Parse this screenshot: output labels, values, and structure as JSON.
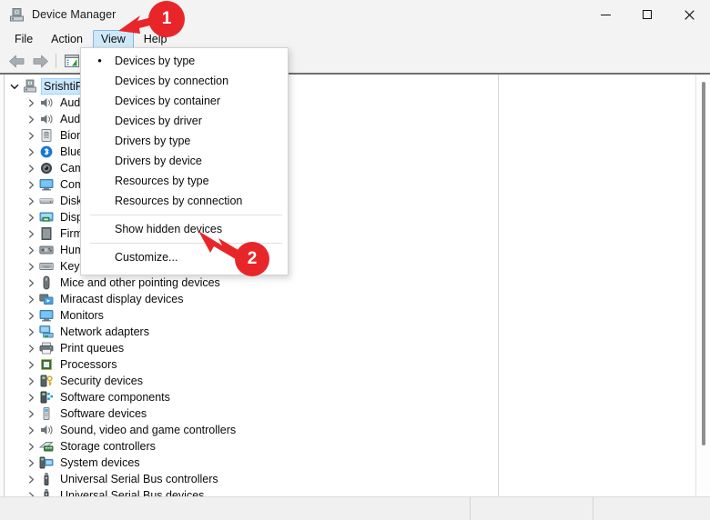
{
  "window": {
    "title": "Device Manager",
    "icon": "device-manager-icon",
    "controls": {
      "minimize": "—",
      "maximize": "□",
      "close": "✕"
    }
  },
  "menubar": {
    "items": [
      {
        "label": "File",
        "active": false
      },
      {
        "label": "Action",
        "active": false
      },
      {
        "label": "View",
        "active": true
      },
      {
        "label": "Help",
        "active": false
      }
    ]
  },
  "toolbar": {
    "buttons": [
      {
        "name": "back-button",
        "icon": "back-arrow-icon"
      },
      {
        "name": "forward-button",
        "icon": "forward-arrow-icon"
      },
      {
        "name": "properties-button",
        "icon": "properties-icon"
      }
    ]
  },
  "view_menu": {
    "items": [
      {
        "label": "Devices by type",
        "checked": true
      },
      {
        "label": "Devices by connection",
        "checked": false
      },
      {
        "label": "Devices by container",
        "checked": false
      },
      {
        "label": "Devices by driver",
        "checked": false
      },
      {
        "label": "Drivers by type",
        "checked": false
      },
      {
        "label": "Drivers by device",
        "checked": false
      },
      {
        "label": "Resources by type",
        "checked": false
      },
      {
        "label": "Resources by connection",
        "checked": false
      },
      {
        "separator": true
      },
      {
        "label": "Show hidden devices",
        "checked": false
      },
      {
        "separator": true
      },
      {
        "label": "Customize...",
        "checked": false
      }
    ]
  },
  "tree": {
    "root": {
      "label": "SrishtiPC",
      "icon": "computer-icon",
      "expanded": true,
      "selected": true
    },
    "items": [
      {
        "label": "Audio inputs and outputs",
        "icon": "speaker-icon"
      },
      {
        "label": "Audio inputs and outputs",
        "icon": "speaker-icon"
      },
      {
        "label": "Biometric devices",
        "icon": "fingerprint-icon"
      },
      {
        "label": "Bluetooth",
        "icon": "bluetooth-icon"
      },
      {
        "label": "Cameras",
        "icon": "camera-icon"
      },
      {
        "label": "Computer",
        "icon": "monitor-icon"
      },
      {
        "label": "Disk drives",
        "icon": "disk-icon"
      },
      {
        "label": "Display adapters",
        "icon": "display-adapter-icon"
      },
      {
        "label": "Firmware",
        "icon": "firmware-icon"
      },
      {
        "label": "Human Interface Devices",
        "icon": "hid-icon"
      },
      {
        "label": "Keyboards",
        "icon": "keyboard-icon"
      },
      {
        "label": "Mice and other pointing devices",
        "icon": "mouse-icon"
      },
      {
        "label": "Miracast display devices",
        "icon": "miracast-icon"
      },
      {
        "label": "Monitors",
        "icon": "monitor-icon"
      },
      {
        "label": "Network adapters",
        "icon": "network-adapter-icon"
      },
      {
        "label": "Print queues",
        "icon": "printer-icon"
      },
      {
        "label": "Processors",
        "icon": "processor-icon"
      },
      {
        "label": "Security devices",
        "icon": "security-key-icon"
      },
      {
        "label": "Software components",
        "icon": "software-component-icon"
      },
      {
        "label": "Software devices",
        "icon": "software-device-icon"
      },
      {
        "label": "Sound, video and game controllers",
        "icon": "speaker-icon"
      },
      {
        "label": "Storage controllers",
        "icon": "storage-controller-icon"
      },
      {
        "label": "System devices",
        "icon": "system-device-icon"
      },
      {
        "label": "Universal Serial Bus controllers",
        "icon": "usb-icon"
      },
      {
        "label": "Universal Serial Bus devices",
        "icon": "usb-icon"
      }
    ]
  },
  "annotations": {
    "accent_color": "#e8262a",
    "markers": [
      {
        "label": "1",
        "points_to": "View menu"
      },
      {
        "label": "2",
        "points_to": "Show hidden devices"
      }
    ]
  }
}
